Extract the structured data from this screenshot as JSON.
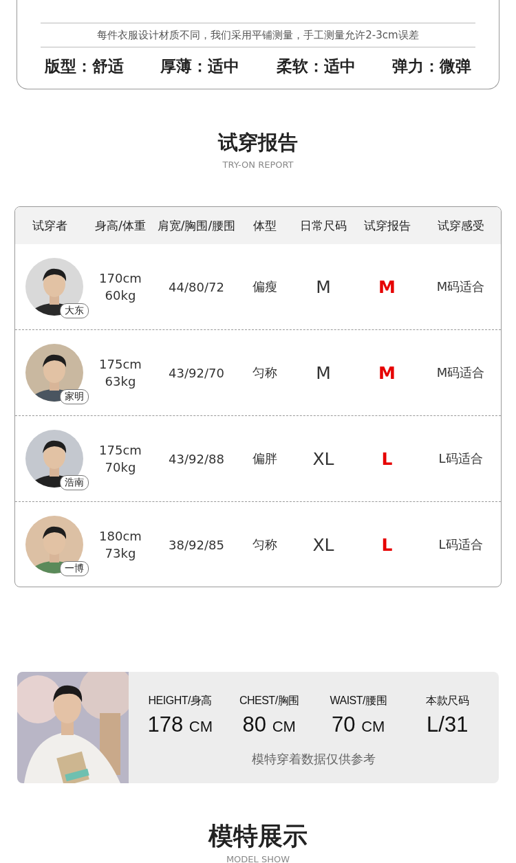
{
  "spec_card": {
    "note": "每件衣服设计材质不同，我们采用平铺测量，手工测量允许2-3cm误差",
    "attributes": [
      "版型：舒适",
      "厚薄：适中",
      "柔软：适中",
      "弹力：微弹"
    ]
  },
  "try_on": {
    "title": "试穿报告",
    "subtitle": "TRY-ON REPORT",
    "columns": [
      "试穿者",
      "身高/体重",
      "肩宽/胸围/腰围",
      "体型",
      "日常尺码",
      "试穿报告",
      "试穿感受"
    ],
    "rows": [
      {
        "name": "大东",
        "height": "170cm",
        "weight": "60kg",
        "measurements": "44/80/72",
        "body_type": "偏瘦",
        "usual_size": "M",
        "report_size": "M",
        "feeling": "M码适合"
      },
      {
        "name": "家明",
        "height": "175cm",
        "weight": "63kg",
        "measurements": "43/92/70",
        "body_type": "匀称",
        "usual_size": "M",
        "report_size": "M",
        "feeling": "M码适合"
      },
      {
        "name": "浩南",
        "height": "175cm",
        "weight": "70kg",
        "measurements": "43/92/88",
        "body_type": "偏胖",
        "usual_size": "XL",
        "report_size": "L",
        "feeling": "L码适合"
      },
      {
        "name": "一博",
        "height": "180cm",
        "weight": "73kg",
        "measurements": "38/92/85",
        "body_type": "匀称",
        "usual_size": "XL",
        "report_size": "L",
        "feeling": "L码适合"
      }
    ]
  },
  "model": {
    "stats": [
      {
        "label": "HEIGHT/身高",
        "value": "178",
        "unit": "CM"
      },
      {
        "label": "CHEST/胸围",
        "value": "80",
        "unit": "CM"
      },
      {
        "label": "WAIST/腰围",
        "value": "70",
        "unit": "CM"
      },
      {
        "label": "本款尺码",
        "value": "L/31"
      }
    ],
    "note": "模特穿着数据仅供参考"
  },
  "model_show": {
    "title": "模特展示",
    "subtitle": "MODEL SHOW"
  }
}
